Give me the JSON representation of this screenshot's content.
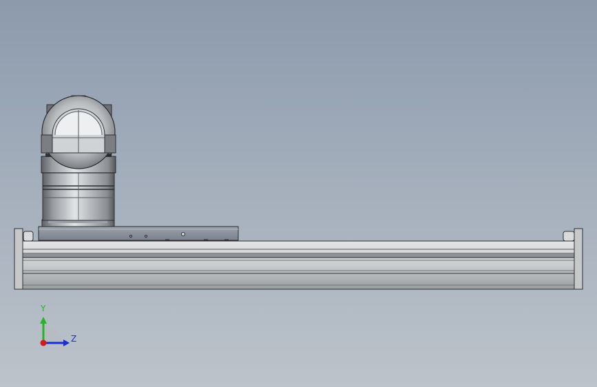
{
  "viewport": {
    "background_top": "#8c9aac",
    "background_bottom": "#bcc3cb"
  },
  "model": {
    "parts": [
      "motor-housing",
      "motor-dome",
      "carriage-plate",
      "linear-rail-base",
      "end-caps"
    ],
    "colors": {
      "metal_light": "#d6d8da",
      "metal_mid": "#a9adb1",
      "metal_dark": "#6f7377",
      "plate": "#8e96a2",
      "edge": "#2b2d30"
    }
  },
  "triad": {
    "y_label": "Y",
    "z_label": "Z",
    "y_color": "#27b327",
    "z_color": "#1a2fd0",
    "origin_color": "#d21c1c"
  }
}
